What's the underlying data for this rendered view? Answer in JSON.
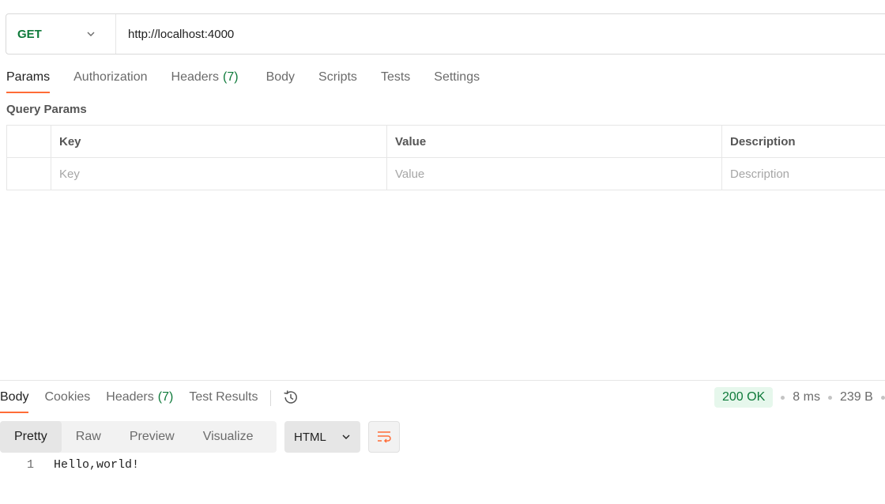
{
  "request": {
    "method": "GET",
    "url": "http://localhost:4000",
    "method_color": "#0e7a3a"
  },
  "request_tabs": {
    "params": "Params",
    "authorization": "Authorization",
    "headers": "Headers",
    "headers_count": "(7)",
    "body": "Body",
    "scripts": "Scripts",
    "tests": "Tests",
    "settings": "Settings"
  },
  "query_params": {
    "title": "Query Params",
    "headers": {
      "key": "Key",
      "value": "Value",
      "description": "Description"
    },
    "placeholders": {
      "key": "Key",
      "value": "Value",
      "description": "Description"
    }
  },
  "response_tabs": {
    "body": "Body",
    "cookies": "Cookies",
    "headers": "Headers",
    "headers_count": "(7)",
    "test_results": "Test Results"
  },
  "status": {
    "code": "200 OK",
    "time": "8 ms",
    "size": "239 B"
  },
  "view_modes": {
    "pretty": "Pretty",
    "raw": "Raw",
    "preview": "Preview",
    "visualize": "Visualize"
  },
  "format": {
    "selected": "HTML"
  },
  "response_body": {
    "lines": [
      {
        "number": "1",
        "text": "Hello,world!"
      }
    ]
  },
  "colors": {
    "accent": "#ff6c37",
    "success": "#0e7a3a",
    "success_bg": "#e6f7ec"
  },
  "icons": {
    "method_dropdown": "chevron-down-icon",
    "history": "history-icon",
    "format_dropdown": "chevron-down-icon",
    "wrap": "wrap-lines-icon"
  }
}
